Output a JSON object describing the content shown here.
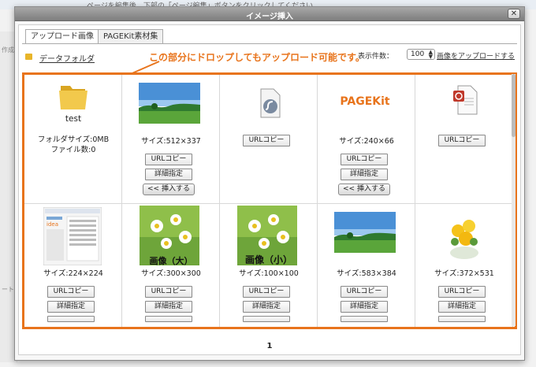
{
  "dialog": {
    "title": "イメージ挿入",
    "close_label": "✕"
  },
  "background": {
    "header_text": "ページを編集後、下部の「ページ編集」ボタンをクリックしてください。",
    "side_text_1": "作成",
    "side_text_2": "ート"
  },
  "tabs": [
    {
      "label": "アップロード画像"
    },
    {
      "label": "PAGEKit素材集"
    }
  ],
  "toolbar": {
    "folder_label": "データフォルダ",
    "annotation": "この部分にドロップしてもアップロード可能です。",
    "count_label": "表示件数：",
    "count_value": "100",
    "upload_link": "画像をアップロードする"
  },
  "buttons": {
    "url_copy": "URLコピー",
    "detail": "詳細指定",
    "insert": "<< 挿入する"
  },
  "row1": {
    "folder_name": "test",
    "folder_size": "フォルダサイズ:0MB",
    "file_count": "ファイル数:0",
    "size_1": "サイズ:512×337",
    "size_3": "サイズ:240×66",
    "logo_text": "PAGEKit",
    "logo_initial": "P"
  },
  "row2": {
    "size_1": "サイズ:224×224",
    "size_2": "サイズ:300×300",
    "size_3": "サイズ:100×100",
    "size_4": "サイズ:583×384",
    "size_5": "サイズ:372×531",
    "overlay_2": "画像（大）",
    "overlay_3": "画像（小）",
    "screenshot_logo": "idea"
  },
  "pager": {
    "current": "1"
  },
  "colors": {
    "accent": "#e8741c",
    "folder": "#e8b52a"
  }
}
